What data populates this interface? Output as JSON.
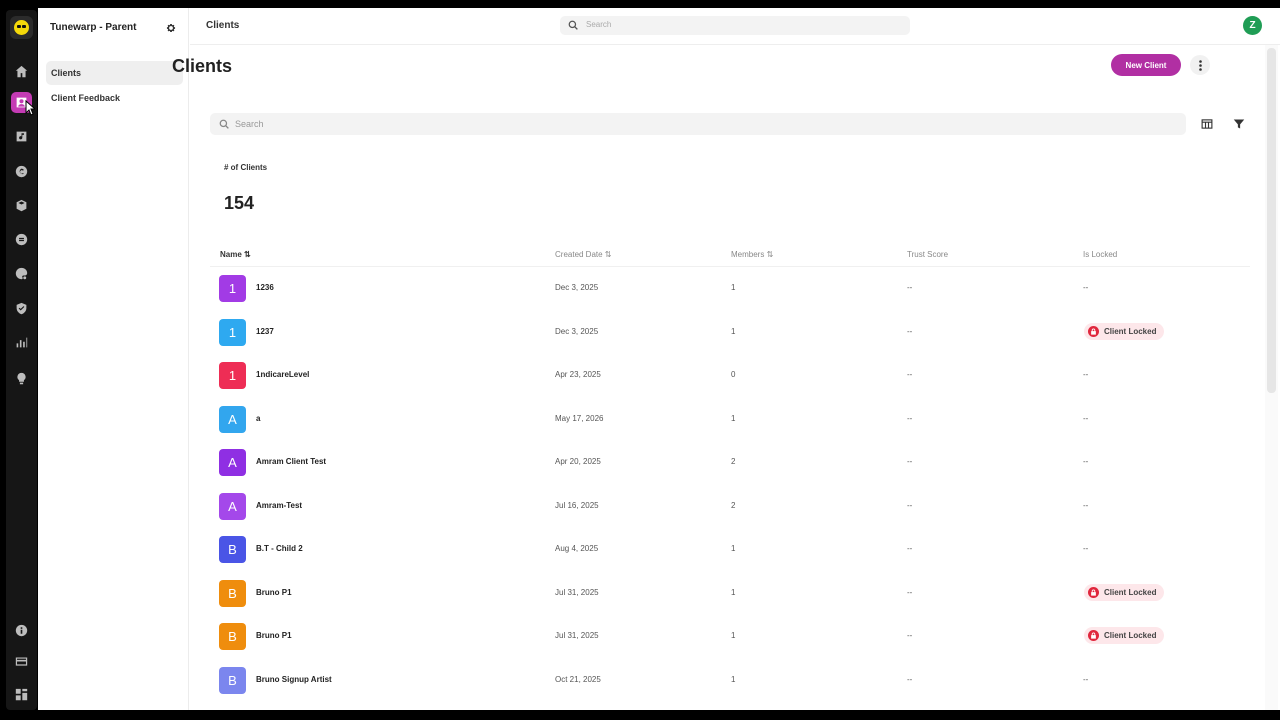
{
  "org": {
    "name": "Tunewarp - Parent"
  },
  "subnav": {
    "items": [
      {
        "label": "Clients"
      },
      {
        "label": "Client Feedback"
      }
    ]
  },
  "header": {
    "breadcrumb": "Clients",
    "search_placeholder": "Search",
    "avatar_initial": "Z"
  },
  "page": {
    "title": "Clients",
    "new_button": "New Client",
    "search_placeholder": "Search",
    "stat_label": "# of Clients",
    "stat_value": "154"
  },
  "table": {
    "columns": {
      "name": "Name ⇅",
      "created": "Created Date ⇅",
      "members": "Members ⇅",
      "trust": "Trust Score",
      "locked": "Is Locked"
    },
    "rows": [
      {
        "initial": "1",
        "color": "#a23be5",
        "name": "1236",
        "created": "Dec 3, 2025",
        "members": "1",
        "trust": "--",
        "locked": "--",
        "is_locked": false
      },
      {
        "initial": "1",
        "color": "#2ea9f0",
        "name": "1237",
        "created": "Dec 3, 2025",
        "members": "1",
        "trust": "--",
        "locked": "Client Locked",
        "is_locked": true
      },
      {
        "initial": "1",
        "color": "#ee2d55",
        "name": "1ndicareLevel",
        "created": "Apr 23, 2025",
        "members": "0",
        "trust": "--",
        "locked": "--",
        "is_locked": false
      },
      {
        "initial": "A",
        "color": "#32a6ee",
        "name": "a",
        "created": "May 17, 2026",
        "members": "1",
        "trust": "--",
        "locked": "--",
        "is_locked": false
      },
      {
        "initial": "A",
        "color": "#8f2fe3",
        "name": "Amram Client Test",
        "created": "Apr 20, 2025",
        "members": "2",
        "trust": "--",
        "locked": "--",
        "is_locked": false
      },
      {
        "initial": "A",
        "color": "#a448ea",
        "name": "Amram-Test",
        "created": "Jul 16, 2025",
        "members": "2",
        "trust": "--",
        "locked": "--",
        "is_locked": false
      },
      {
        "initial": "B",
        "color": "#4a55e6",
        "name": "B.T - Child 2",
        "created": "Aug 4, 2025",
        "members": "1",
        "trust": "--",
        "locked": "--",
        "is_locked": false
      },
      {
        "initial": "B",
        "color": "#ef8d0d",
        "name": "Bruno P1",
        "created": "Jul 31, 2025",
        "members": "1",
        "trust": "--",
        "locked": "Client Locked",
        "is_locked": true
      },
      {
        "initial": "B",
        "color": "#ef8d0d",
        "name": "Bruno P1",
        "created": "Jul 31, 2025",
        "members": "1",
        "trust": "--",
        "locked": "Client Locked",
        "is_locked": true
      },
      {
        "initial": "B",
        "color": "#7b86ee",
        "name": "Bruno Signup Artist",
        "created": "Oct 21, 2025",
        "members": "1",
        "trust": "--",
        "locked": "--",
        "is_locked": false
      }
    ]
  },
  "rail": {
    "icons": [
      "home-icon",
      "clients-icon",
      "music-icon",
      "copyright-icon",
      "box-icon",
      "coin-icon",
      "palette-icon",
      "shield-icon",
      "chart-icon",
      "bulb-icon",
      "info-icon",
      "card-icon",
      "dashboard-icon"
    ]
  }
}
